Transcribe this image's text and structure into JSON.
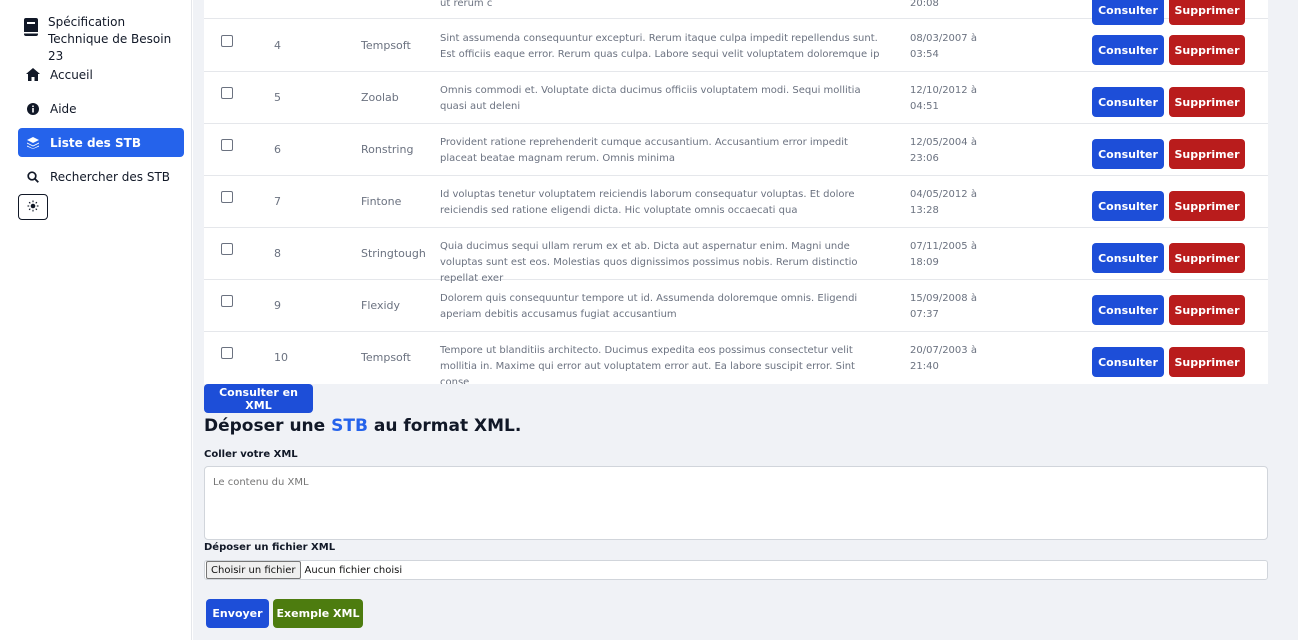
{
  "sidebar": {
    "title": "Spécification Technique de Besoin 23",
    "items": [
      {
        "label": "Accueil"
      },
      {
        "label": "Aide"
      },
      {
        "label": "Liste des STB"
      },
      {
        "label": "Rechercher des STB"
      }
    ]
  },
  "table": {
    "rows": [
      {
        "num": "",
        "company": "",
        "desc": "ut rerum c",
        "date": "20:08",
        "top_partial": true
      },
      {
        "num": "4",
        "company": "Tempsoft",
        "desc": "Sint assumenda consequuntur excepturi. Rerum itaque culpa impedit repellendus sunt. Est officiis eaque error. Rerum quas culpa. Labore sequi velit voluptatem doloremque ip",
        "date": "08/03/2007 à 03:54"
      },
      {
        "num": "5",
        "company": "Zoolab",
        "desc": "Omnis commodi et. Voluptate dicta ducimus officiis voluptatem modi. Sequi mollitia quasi aut deleni",
        "date": "12/10/2012 à 04:51"
      },
      {
        "num": "6",
        "company": "Ronstring",
        "desc": "Provident ratione reprehenderit cumque accusantium. Accusantium error impedit placeat beatae magnam rerum. Omnis minima",
        "date": "12/05/2004 à 23:06"
      },
      {
        "num": "7",
        "company": "Fintone",
        "desc": "Id voluptas tenetur voluptatem reiciendis laborum consequatur voluptas. Et dolore reiciendis sed ratione eligendi dicta. Hic voluptate omnis occaecati qua",
        "date": "04/05/2012 à 13:28"
      },
      {
        "num": "8",
        "company": "Stringtough",
        "desc": "Quia ducimus sequi ullam rerum ex et ab. Dicta aut aspernatur enim. Magni unde voluptas sunt est eos. Molestias quos dignissimos possimus nobis. Rerum distinctio repellat exer",
        "date": "07/11/2005 à 18:09"
      },
      {
        "num": "9",
        "company": "Flexidy",
        "desc": "Dolorem quis consequuntur tempore ut id. Assumenda doloremque omnis. Eligendi aperiam debitis accusamus fugiat accusantium",
        "date": "15/09/2008 à 07:37"
      },
      {
        "num": "10",
        "company": "Tempsoft",
        "desc": "Tempore ut blanditiis architecto. Ducimus expedita eos possimus consectetur velit mollitia in. Maxime qui error aut voluptatem error aut. Ea labore suscipit error. Sint conse",
        "date": "20/07/2003 à 21:40"
      }
    ],
    "consult_label": "Consulter",
    "delete_label": "Supprimer"
  },
  "xml_button_label": "Consulter en XML",
  "upload": {
    "title_before": "Déposer une",
    "title_accent": "STB",
    "title_after": "au format XML.",
    "paste_label": "Coller votre XML",
    "paste_placeholder": "Le contenu du XML",
    "file_label": "Déposer un fichier XML",
    "file_button": "Choisir un fichier",
    "file_status": "Aucun fichier choisi",
    "send_label": "Envoyer",
    "example_label": "Exemple XML"
  },
  "colors": {
    "primary": "#1d4ed8",
    "danger": "#b91c1c",
    "success": "#4d7c0f",
    "active_nav": "#2563eb"
  }
}
